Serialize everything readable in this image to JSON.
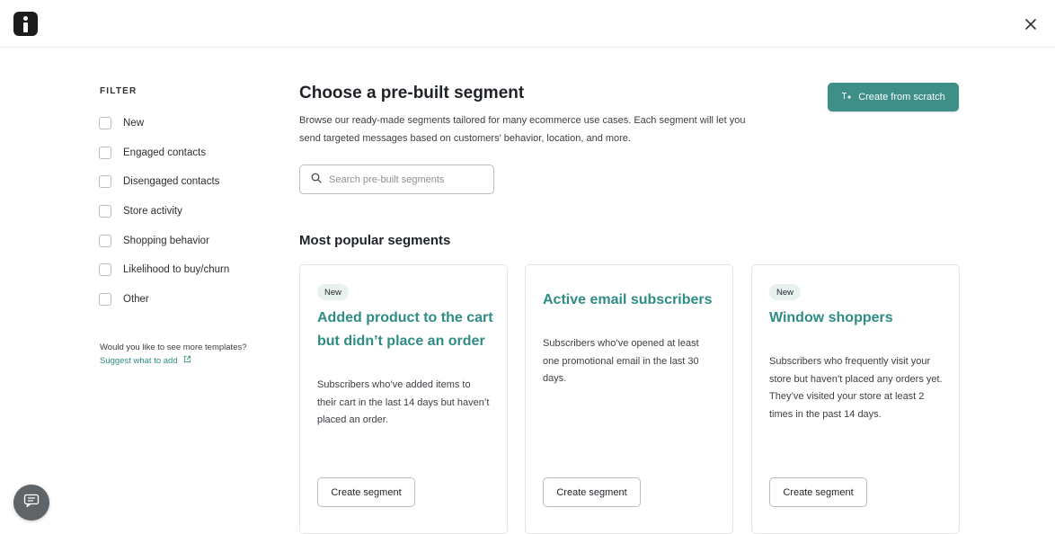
{
  "header": {
    "logo_icon": "brand-logo-icon",
    "close_icon": "close-icon"
  },
  "sidebar": {
    "filter_title": "FILTER",
    "filters": [
      {
        "label": "New",
        "checked": false
      },
      {
        "label": "Engaged contacts",
        "checked": false
      },
      {
        "label": "Disengaged contacts",
        "checked": false
      },
      {
        "label": "Store activity",
        "checked": false
      },
      {
        "label": "Shopping behavior",
        "checked": false
      },
      {
        "label": "Likelihood to buy/churn",
        "checked": false
      },
      {
        "label": "Other",
        "checked": false
      }
    ],
    "more_question": "Would you like to see more templates?",
    "suggest_link": "Suggest what to add",
    "suggest_icon": "external-link-icon"
  },
  "main": {
    "title": "Choose a pre-built segment",
    "description": "Browse our ready-made segments tailored for many ecommerce use cases. Each segment will let you send targeted messages based on customers' behavior, location, and more.",
    "search_placeholder": "Search pre-built segments",
    "search_icon": "search-icon",
    "create_scratch_label": "Create from scratch",
    "create_scratch_icon": "text-plus-icon",
    "accent_color": "#3d8f88"
  },
  "popular": {
    "section_title": "Most popular segments",
    "cards": [
      {
        "badge": "New",
        "title": "Added product to the cart but didn’t place an order",
        "description": "Subscribers who’ve added items to their cart in the last 14 days but haven’t placed an order.",
        "button": "Create segment"
      },
      {
        "badge": "",
        "title": "Active email subscribers",
        "description": "Subscribers who’ve opened at least one promotional email in the last 30 days.",
        "button": "Create segment"
      },
      {
        "badge": "New",
        "title": "Window shoppers",
        "description": "Subscribers who frequently visit your store but haven’t placed any orders yet. They’ve visited your store at least 2 times in the past 14 days.",
        "button": "Create segment"
      }
    ]
  },
  "chat": {
    "icon": "chat-bubble-icon"
  }
}
